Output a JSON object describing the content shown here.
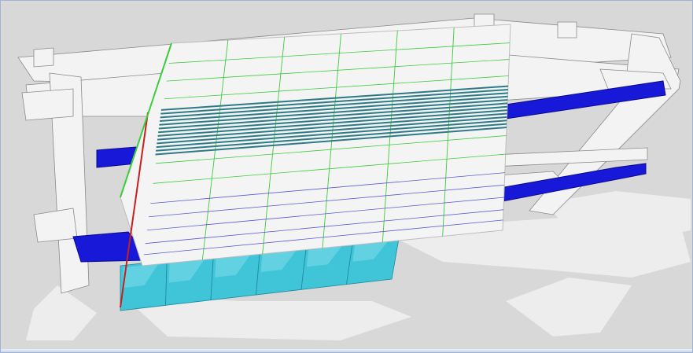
{
  "viewport": {
    "kind": "3d-model-view",
    "background_color": "#d8d8d8",
    "shadow_color": "#ededed",
    "colors": {
      "frame_fill": "#f3f3f3",
      "frame_edge": "#8a8a8a",
      "blue_beam": "#1818d8",
      "blue_beam_dark": "#0a0a90",
      "panel_fill": "#f4f4f4",
      "panel_grid_green": "#3ccc3c",
      "panel_grid_blue": "#5a5ad8",
      "louver_stripe": "#2d7a86",
      "glass_cyan": "#3fc4d8",
      "glass_cyan_light": "#8ee4ef",
      "edge_red": "#c81e1e"
    },
    "objects": [
      {
        "name": "steel-gantry-frame"
      },
      {
        "name": "upper-blue-beam"
      },
      {
        "name": "lower-blue-beam"
      },
      {
        "name": "facade-panel-grid"
      },
      {
        "name": "louver-band"
      },
      {
        "name": "cyan-glass-panels"
      }
    ]
  }
}
